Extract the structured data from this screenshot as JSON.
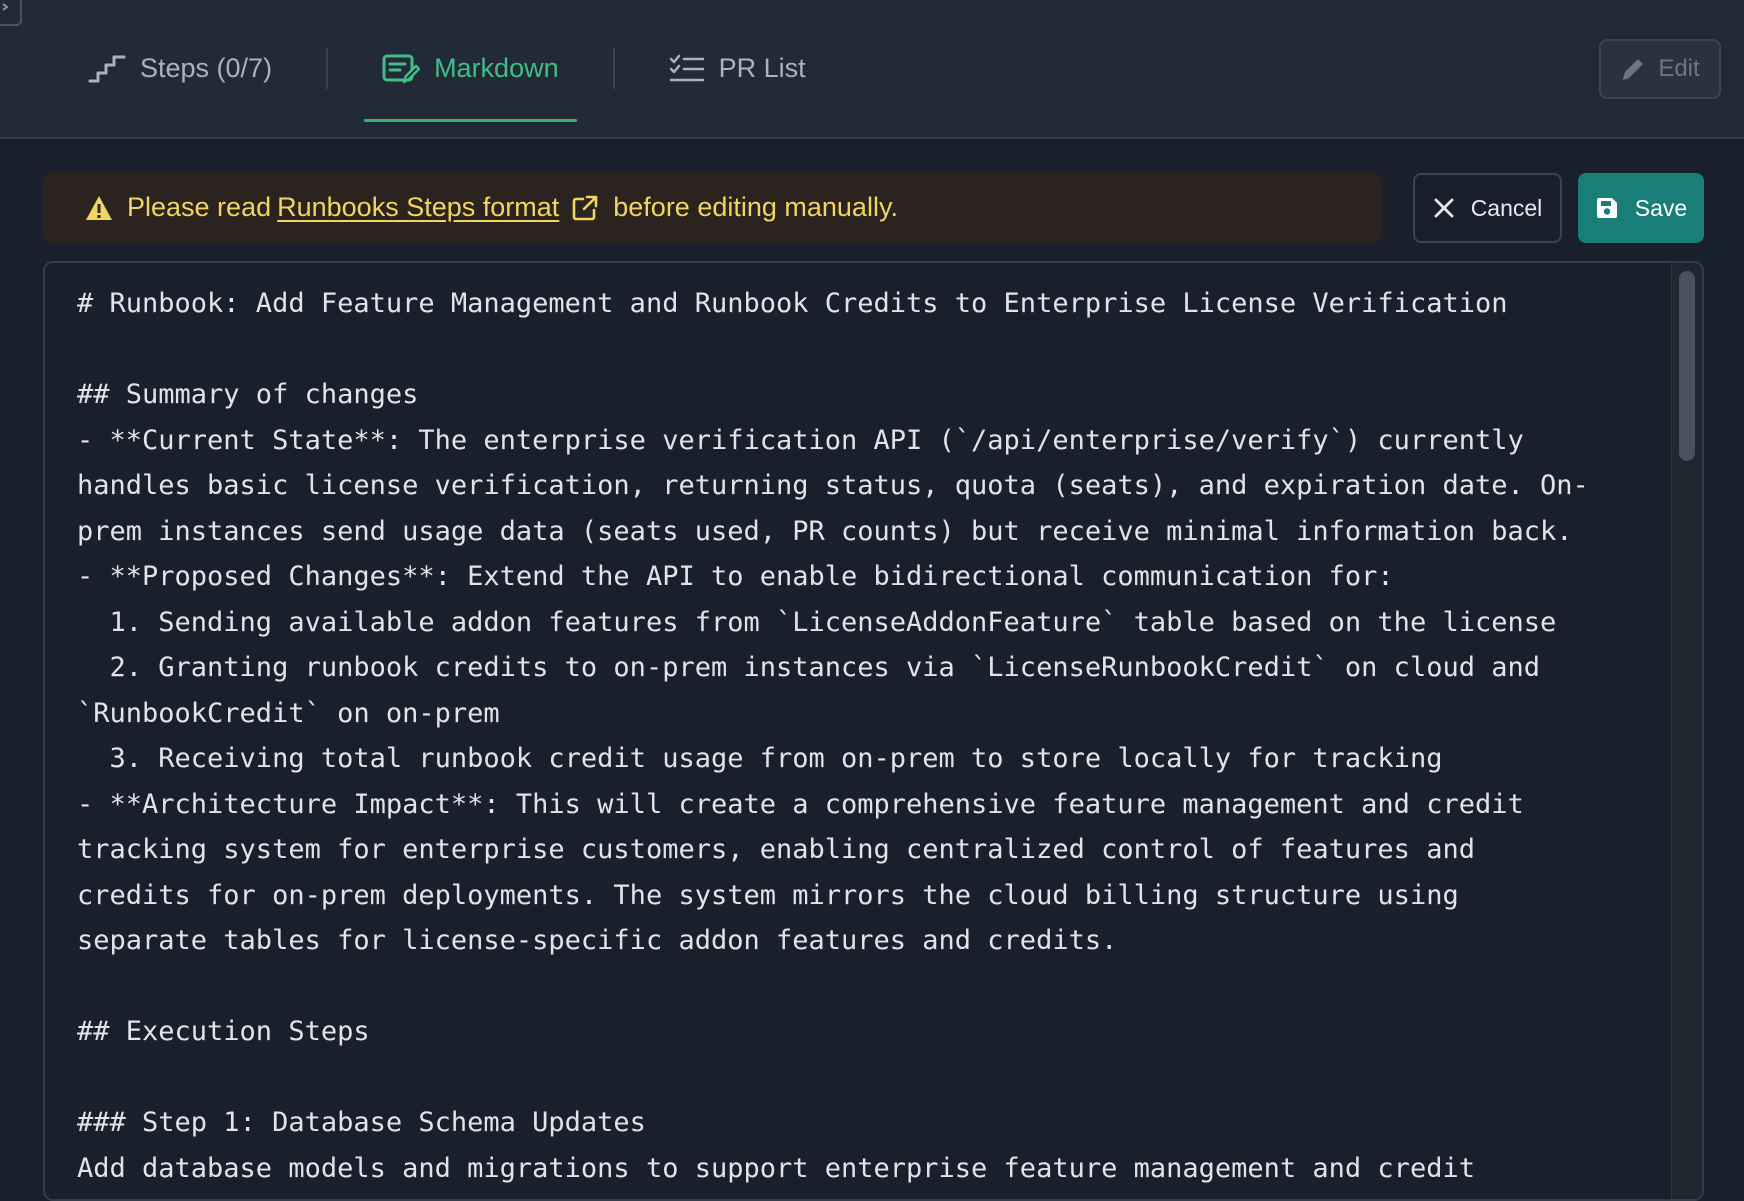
{
  "tabs": [
    {
      "label": "Steps (0/7)",
      "icon": "steps-icon",
      "active": false
    },
    {
      "label": "Markdown",
      "icon": "markdown-edit-icon",
      "active": true
    },
    {
      "label": "PR List",
      "icon": "checklist-icon",
      "active": false
    }
  ],
  "toolbar": {
    "edit_label": "Edit",
    "cancel_label": "Cancel",
    "save_label": "Save"
  },
  "banner": {
    "prefix": "Please read",
    "link_text": "Runbooks Steps format",
    "suffix": "before editing manually."
  },
  "colors": {
    "accent_green": "#3fbf87",
    "save_button": "#197e77",
    "warning_text": "#f2d55e",
    "background": "#1a1f2c"
  },
  "editor": {
    "lines": [
      "# Runbook: Add Feature Management and Runbook Credits to Enterprise License Verification",
      "",
      "## Summary of changes",
      "- **Current State**: The enterprise verification API (`/api/enterprise/verify`) currently",
      "handles basic license verification, returning status, quota (seats), and expiration date. On-",
      "prem instances send usage data (seats used, PR counts) but receive minimal information back.",
      "- **Proposed Changes**: Extend the API to enable bidirectional communication for:",
      "  1. Sending available addon features from `LicenseAddonFeature` table based on the license",
      "  2. Granting runbook credits to on-prem instances via `LicenseRunbookCredit` on cloud and",
      "`RunbookCredit` on on-prem",
      "  3. Receiving total runbook credit usage from on-prem to store locally for tracking",
      "- **Architecture Impact**: This will create a comprehensive feature management and credit",
      "tracking system for enterprise customers, enabling centralized control of features and",
      "credits for on-prem deployments. The system mirrors the cloud billing structure using",
      "separate tables for license-specific addon features and credits.",
      "",
      "## Execution Steps",
      "",
      "### Step 1: Database Schema Updates",
      "Add database models and migrations to support enterprise feature management and credit"
    ]
  }
}
